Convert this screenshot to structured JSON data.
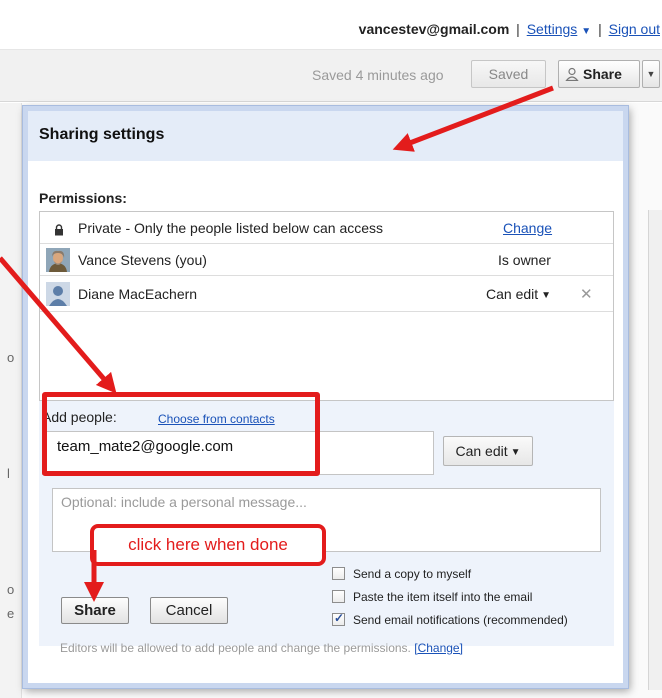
{
  "header": {
    "account_email": "vancestev@gmail.com",
    "separator": "|",
    "settings_label": "Settings",
    "sign_out_label": "Sign out"
  },
  "toolbar": {
    "saved_status": "Saved 4 minutes ago",
    "saved_button": "Saved",
    "share_button": "Share"
  },
  "background_fragments": [
    "o",
    "l",
    "o",
    "e"
  ],
  "dialog": {
    "title": "Sharing settings",
    "permissions_label": "Permissions:",
    "permissions": [
      {
        "name": "Private - Only the people listed below can access",
        "action": "Change",
        "icon": "lock-icon"
      },
      {
        "name": "Vance Stevens (you)",
        "role": "Is owner",
        "icon": "avatar-photo"
      },
      {
        "name": "Diane MacEachern",
        "role": "Can edit",
        "icon": "avatar-default"
      }
    ],
    "add_people_label": "Add people:",
    "choose_contacts": "Choose from contacts",
    "email_value": "team_mate2@google.com",
    "permission_dropdown": "Can edit",
    "message_placeholder": "Optional: include a personal message...",
    "options": [
      {
        "label": "Send a copy to myself",
        "checked": false
      },
      {
        "label": "Paste the item itself into the email",
        "checked": false
      },
      {
        "label": "Send email notifications (recommended)",
        "checked": true
      }
    ],
    "share_button": "Share",
    "cancel_button": "Cancel",
    "footer_note": "Editors will be allowed to add people and change the permissions.",
    "footer_link": "[Change]"
  },
  "annotation": {
    "callout_text": "click here when done",
    "color": "#e31c1c"
  }
}
